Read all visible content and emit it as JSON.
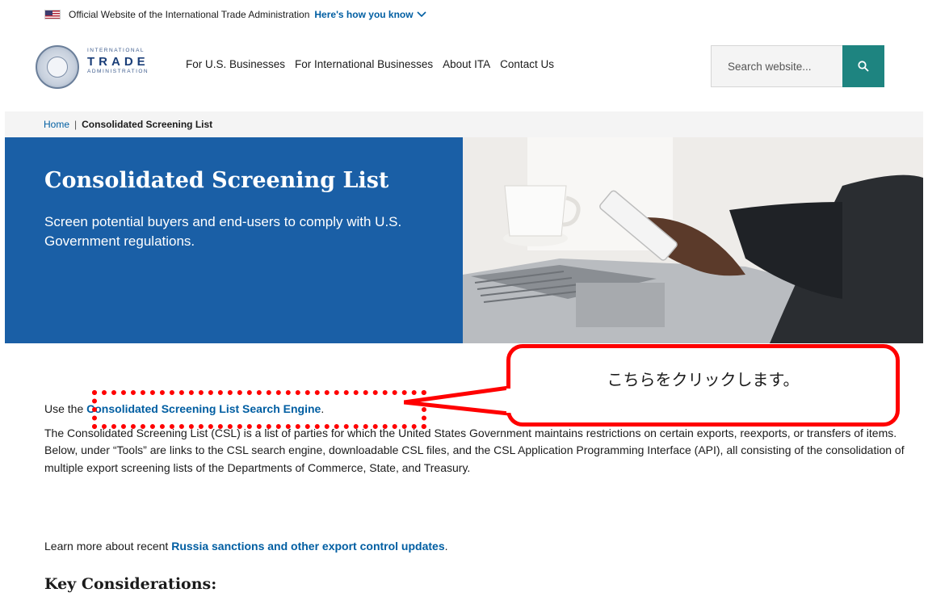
{
  "gov_banner": {
    "text": "Official Website of the International Trade Administration",
    "how_you_know": "Here's how you know"
  },
  "logo": {
    "line1": "INTERNATIONAL",
    "line2": "TRADE",
    "line3": "ADMINISTRATION"
  },
  "nav": {
    "items": [
      "For U.S. Businesses",
      "For International Businesses",
      "About ITA",
      "Contact Us"
    ]
  },
  "search": {
    "placeholder": "Search website..."
  },
  "breadcrumb": {
    "home": "Home",
    "separator": "|",
    "current": "Consolidated Screening List"
  },
  "hero": {
    "title": "Consolidated Screening List",
    "subtitle": "Screen potential buyers and end-users to comply with U.S. Government regulations."
  },
  "content": {
    "p1_prefix": "Use the ",
    "p1_link": "Consolidated Screening List Search Engine",
    "p1_suffix": ".",
    "p2": "The Consolidated Screening List (CSL) is a list of parties for which the United States Government maintains restrictions on certain exports, reexports, or transfers of items. Below, under “Tools” are links to the CSL search engine, downloadable CSL files, and the CSL Application Programming Interface (API), all consisting of the consolidation of multiple export screening lists of the Departments of Commerce, State, and Treasury.",
    "p3_prefix": "Learn more about recent ",
    "p3_link": "Russia sanctions and other export control updates",
    "p3_suffix": ".",
    "heading": "Key Considerations:"
  },
  "annotation": {
    "callout_text": "こちらをクリックします。"
  },
  "colors": {
    "hero_blue": "#1a5fa6",
    "link_blue": "#005ea2",
    "search_teal": "#1e8480",
    "annotation_red": "#ff0000"
  }
}
